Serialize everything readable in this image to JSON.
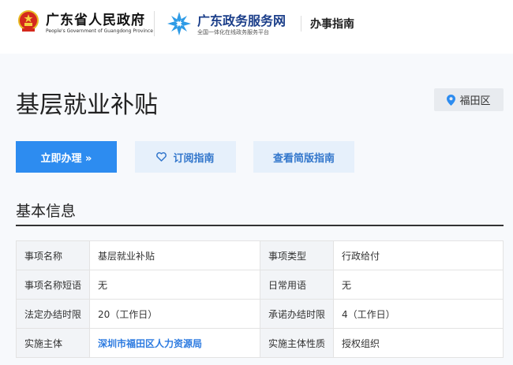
{
  "header": {
    "gov_name": "广东省人民政府",
    "gov_subtitle": "People's Government of Guangdong Province",
    "service_name": "广东政务服务网",
    "service_subtitle": "全国一体化在线政务服务平台",
    "guide_link": "办事指南"
  },
  "page": {
    "title": "基层就业补贴",
    "region": "福田区"
  },
  "actions": {
    "apply_label": "立即办理 »",
    "subscribe_label": "订阅指南",
    "simple_guide_label": "查看简版指南"
  },
  "section": {
    "title": "基本信息"
  },
  "info_rows": [
    [
      {
        "label": "事项名称",
        "value": "基层就业补贴"
      },
      {
        "label": "事项类型",
        "value": "行政给付"
      }
    ],
    [
      {
        "label": "事项名称短语",
        "value": "无"
      },
      {
        "label": "日常用语",
        "value": "无"
      }
    ],
    [
      {
        "label": "法定办结时限",
        "value": "20（工作日）"
      },
      {
        "label": "承诺办结时限",
        "value": "4（工作日）"
      }
    ],
    [
      {
        "label": "实施主体",
        "value": "深圳市福田区人力资源局"
      },
      {
        "label": "实施主体性质",
        "value": "授权组织"
      }
    ]
  ],
  "colors": {
    "primary": "#2d8cf0",
    "secondary_bg": "#e6f0fb",
    "link": "#2d7be0"
  },
  "icons": [
    "national-emblem-icon",
    "service-logo-icon",
    "location-pin-icon",
    "heart-icon"
  ]
}
